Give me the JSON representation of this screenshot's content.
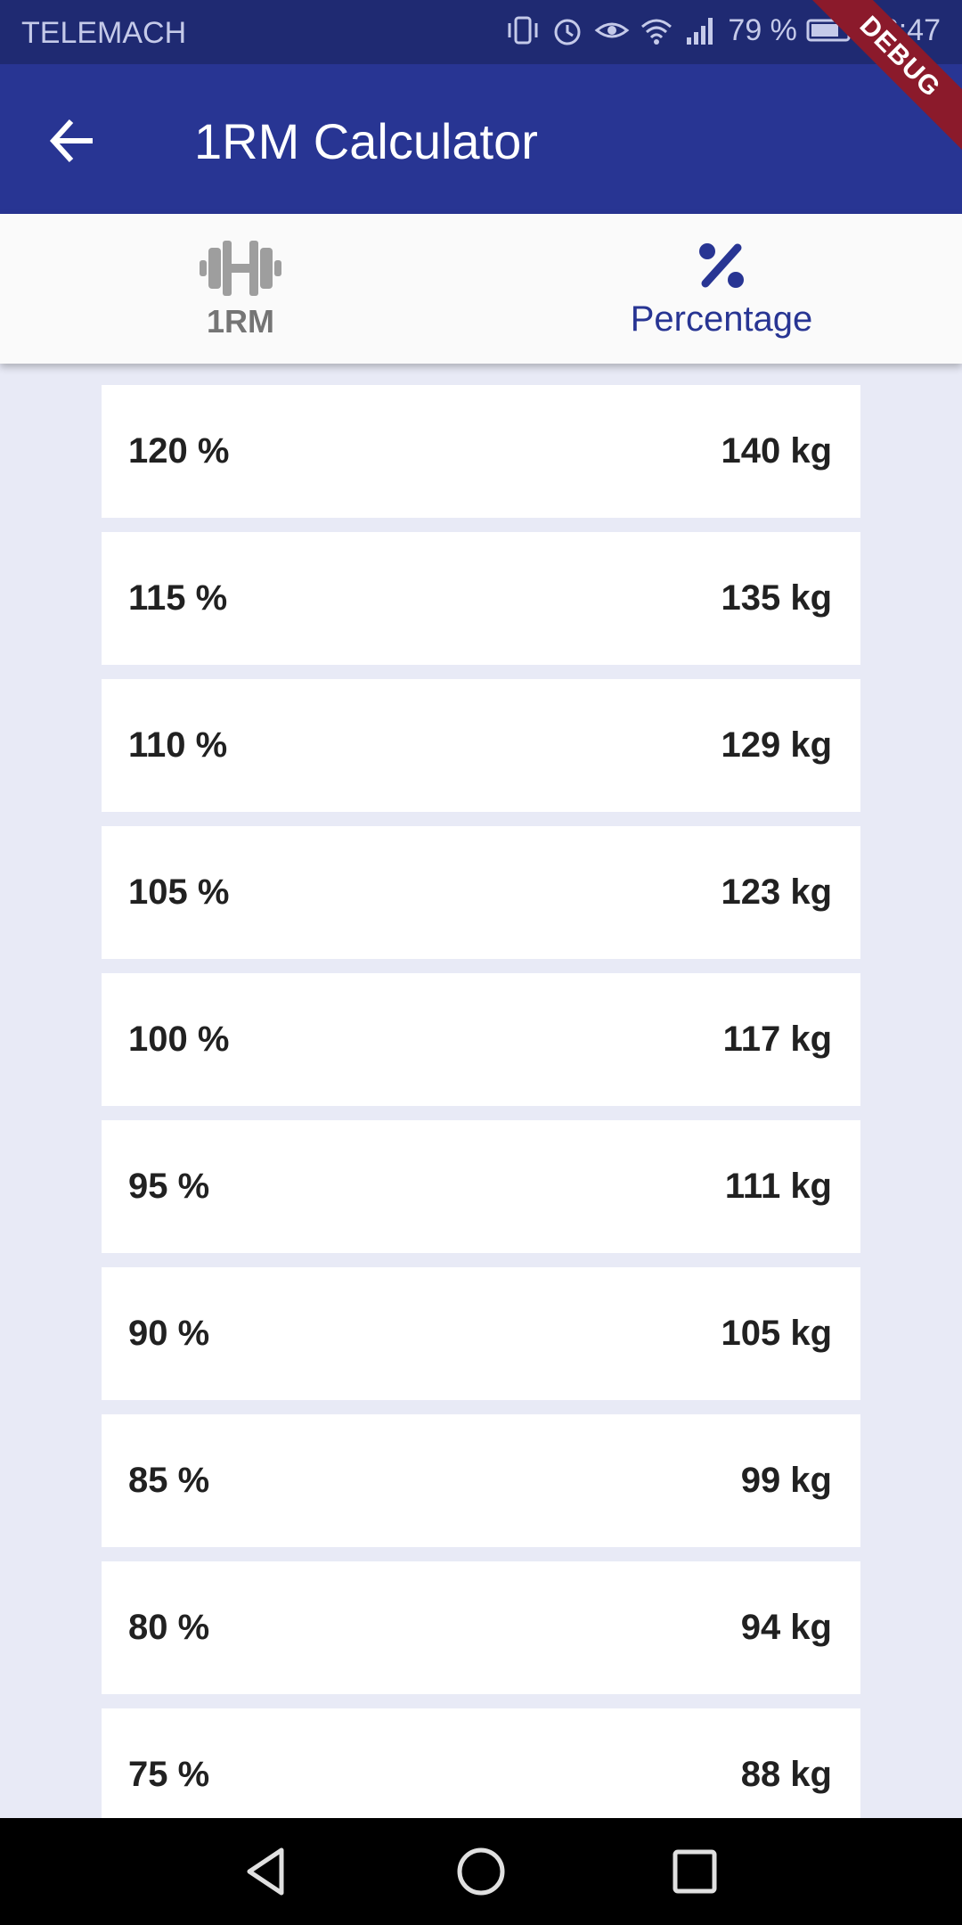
{
  "status_bar": {
    "carrier": "TELEMACH",
    "battery": "79 %",
    "time": "16:47",
    "icons": [
      "vibrate-icon",
      "alarm-icon",
      "eye-icon",
      "wifi-icon",
      "signal-icon",
      "battery-icon"
    ]
  },
  "debug_banner": "DEBUG",
  "app_bar": {
    "title": "1RM Calculator",
    "back_icon": "arrow-back-icon"
  },
  "tabs": [
    {
      "label": "1RM",
      "icon": "dumbbell-icon",
      "selected": false
    },
    {
      "label": "Percentage",
      "icon": "percent-icon",
      "selected": true
    }
  ],
  "rows": [
    {
      "percent": "120 %",
      "weight": "140 kg"
    },
    {
      "percent": "115 %",
      "weight": "135 kg"
    },
    {
      "percent": "110 %",
      "weight": "129 kg"
    },
    {
      "percent": "105 %",
      "weight": "123 kg"
    },
    {
      "percent": "100 %",
      "weight": "117 kg"
    },
    {
      "percent": "95 %",
      "weight": "111 kg"
    },
    {
      "percent": "90 %",
      "weight": "105 kg"
    },
    {
      "percent": "85 %",
      "weight": "99 kg"
    },
    {
      "percent": "80 %",
      "weight": "94 kg"
    },
    {
      "percent": "75 %",
      "weight": "88 kg"
    }
  ],
  "colors": {
    "primary": "#283593",
    "status_bar": "#1f2a72",
    "background": "#e8eaf6",
    "debug": "#8b1a2b"
  },
  "nav_bar": {
    "buttons": [
      "back-triangle-icon",
      "home-circle-icon",
      "recents-square-icon"
    ]
  }
}
